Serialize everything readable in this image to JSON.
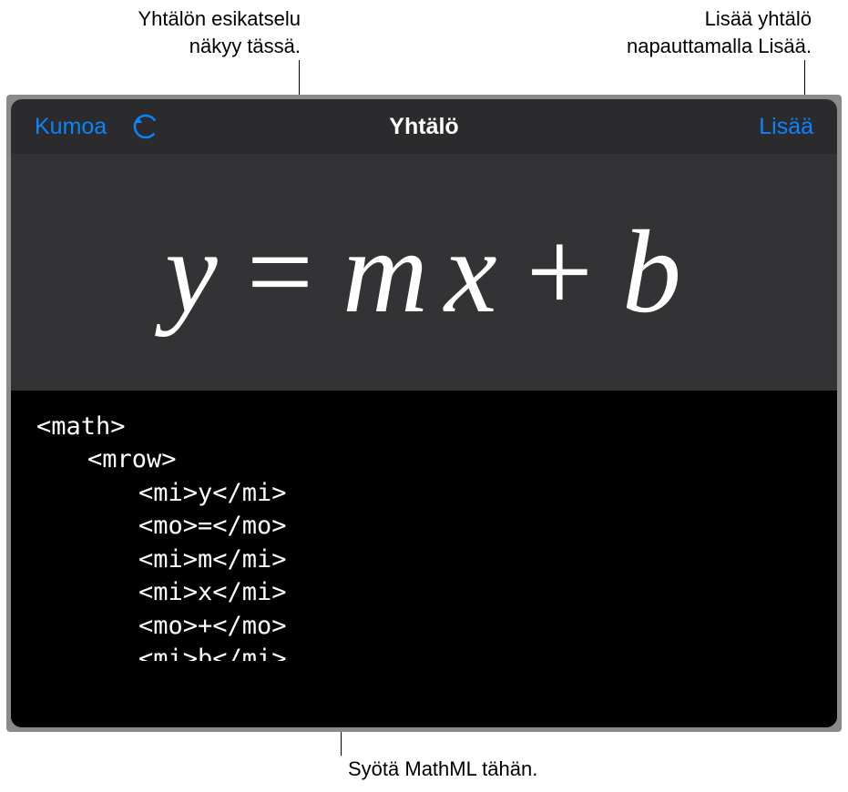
{
  "callouts": {
    "preview": "Yhtälön esikatselu\nnäkyy tässä.",
    "insert": "Lisää yhtälö\nnapauttamalla Lisää.",
    "input": "Syötä MathML tähän."
  },
  "toolbar": {
    "undo_label": "Kumoa",
    "title": "Yhtälö",
    "insert_label": "Lisää"
  },
  "equation": {
    "y": "y",
    "eq": "=",
    "m": "m",
    "x": "x",
    "plus": "+",
    "b": "b"
  },
  "code": {
    "l1": "<math>",
    "l2": "<mrow>",
    "l3": "<mi>y</mi>",
    "l4": "<mo>=</mo>",
    "l5": "<mi>m</mi>",
    "l6": "<mi>x</mi>",
    "l7": "<mo>+</mo>",
    "l8": "<mi>b</mi>"
  },
  "colors": {
    "accent": "#0a84ff",
    "panel_bg": "#2b2b2d",
    "preview_bg": "#333335",
    "code_bg": "#000000"
  }
}
